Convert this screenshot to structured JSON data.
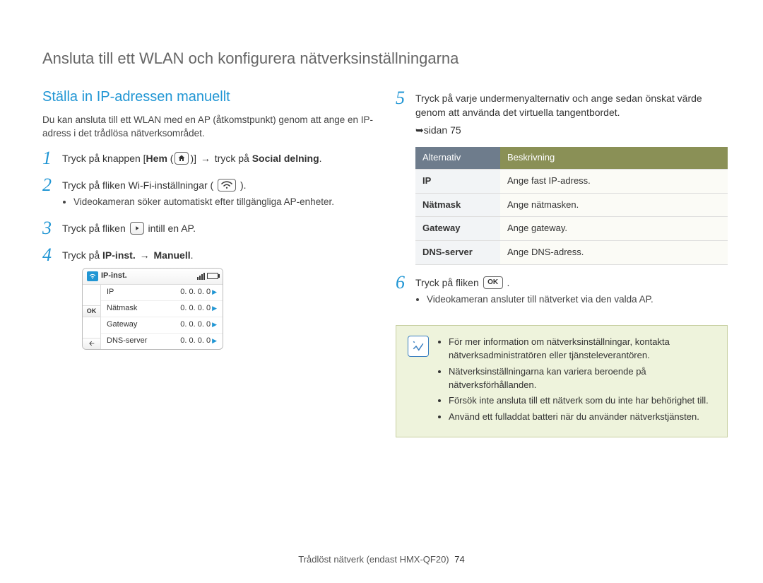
{
  "page_title": "Ansluta till ett WLAN och konfigurera nätverksinställningarna",
  "section_title": "Ställa in IP-adressen manuellt",
  "intro": "Du kan ansluta till ett WLAN med en AP (åtkomstpunkt) genom att ange en IP-adress i det trådlösa nätverksområdet.",
  "steps_left": [
    {
      "num": "1",
      "parts": [
        "Tryck på knappen [",
        "Hem",
        " (",
        {
          "icon": "home"
        },
        ")] ",
        {
          "arrow": true
        },
        " tryck på ",
        "Social delning",
        "."
      ]
    },
    {
      "num": "2",
      "parts": [
        "Tryck på fliken Wi-Fi-inställningar ( ",
        {
          "icon": "wifi"
        },
        " )."
      ],
      "bullets": [
        "Videokameran söker automatiskt efter tillgängliga AP-enheter."
      ]
    },
    {
      "num": "3",
      "parts": [
        "Tryck på fliken ",
        {
          "icon": "play"
        },
        " intill en AP."
      ]
    },
    {
      "num": "4",
      "parts": [
        "Tryck på ",
        "IP-inst.",
        " ",
        {
          "arrow": true
        },
        " ",
        "Manuell",
        "."
      ],
      "device": true
    }
  ],
  "steps_right": [
    {
      "num": "5",
      "parts": [
        "Tryck på varje undermenyalternativ och ange sedan önskat värde genom att använda det virtuella tangentbordet."
      ],
      "ref": "sidan 75"
    },
    {
      "num": "6",
      "parts": [
        "Tryck på fliken ",
        {
          "icon": "ok"
        },
        " ."
      ],
      "bullets": [
        "Videokameran ansluter till nätverket via den valda AP."
      ]
    }
  ],
  "step5_ref_prefix": "➥",
  "table": {
    "header": [
      "Alternativ",
      "Beskrivning"
    ],
    "rows": [
      [
        "IP",
        "Ange fast IP-adress."
      ],
      [
        "Nätmask",
        "Ange nätmasken."
      ],
      [
        "Gateway",
        "Ange gateway."
      ],
      [
        "DNS-server",
        "Ange DNS-adress."
      ]
    ]
  },
  "device": {
    "title": "IP-inst.",
    "rows": [
      {
        "label": "IP",
        "value": "0. 0. 0. 0"
      },
      {
        "label": "Nätmask",
        "value": "0. 0. 0. 0"
      },
      {
        "label": "Gateway",
        "value": "0. 0. 0. 0"
      },
      {
        "label": "DNS-server",
        "value": "0. 0. 0. 0"
      }
    ],
    "ok_label": "OK"
  },
  "notes": [
    "För mer information om nätverksinställningar, kontakta nätverksadministratören eller tjänsteleverantören.",
    "Nätverksinställningarna kan variera beroende på nätverksförhållanden.",
    "Försök inte ansluta till ett nätverk som du inte har behörighet till.",
    "Använd ett fulladdat batteri när du använder nätverkstjänsten."
  ],
  "footer_text": "Trådlöst nätverk (endast HMX-QF20)",
  "footer_page": "74",
  "ok_text": "OK"
}
